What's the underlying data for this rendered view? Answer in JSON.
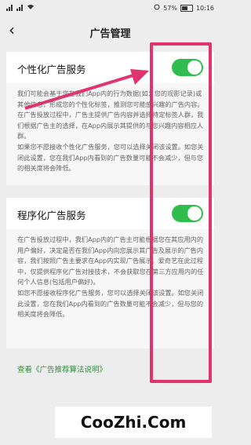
{
  "status_bar": {
    "battery": "57%",
    "time": "10:16"
  },
  "header": {
    "title": "广告管理"
  },
  "personalized": {
    "title": "个性化广告服务",
    "toggle_on": true,
    "desc_p1": "我们可能会基于您在我们App内的行为数据(如：您的观影记录)或其他信息，形成您的个性化标签，推测您可能感兴趣的广告内容。在广告投放过程中，广告主提供广告内容并选择特定标签人群，我们根据广告主的选择，在App内展示其提供的与您兴趣内容相应人群。",
    "desc_p2": "如果您不愿接收个性化广告服务，您可以选择关闭该设置。如您关闭此设置，您在我们App内看到的广告数量可能不会减少，但与您的相关度将会降低。"
  },
  "programmatic": {
    "title": "程序化广告服务",
    "toggle_on": true,
    "desc_p1": "在广告投放过程中，我们App内的广告主可能根据您在其应用内的用户偏好，决定是否在我们App内向您展示其广告及展示的广告内容，我们按照广告主要求在App内实现广告展示。爱奇艺在此过程中，仅提供程序化广告对接技术，不会获取您在第三方应用内的任何个人信息(包括用户偏好)。",
    "desc_p2": "如您不愿接收程序化广告服务，您可以选择关闭该设置。如您关闭此设置，您在我们App内看到的广告数量可能不会减少，但与您的相关度将会降低。"
  },
  "link": {
    "label": "查看《广告推荐算法说明》"
  },
  "watermark": {
    "text": "CooZhi.Com"
  },
  "colors": {
    "toggle_on": "#2fbd4e",
    "highlight": "#e0336f",
    "link": "#2f8f3c"
  }
}
